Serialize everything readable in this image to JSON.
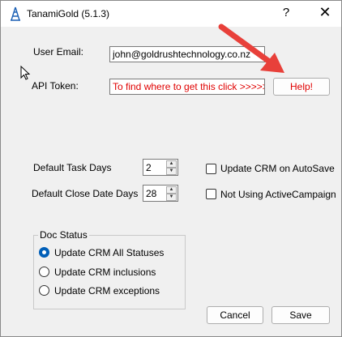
{
  "window": {
    "title": "TanamiGold (5.1.3)",
    "help_glyph": "?",
    "close_glyph": "✕"
  },
  "form": {
    "email_label": "User Email:",
    "email_value": "john@goldrushtechnology.co.nz",
    "api_label": "API Token:",
    "api_hint": "To find where to get this click >>>>>",
    "help_button": "Help!",
    "task_days_label": "Default Task Days",
    "task_days_value": "2",
    "close_days_label": "Default Close Date Days",
    "close_days_value": "28",
    "crm_autosave_label": "Update CRM on AutoSave",
    "crm_autosave_checked": false,
    "not_activecampaign_label": "Not Using ActiveCampaign",
    "not_activecampaign_checked": false
  },
  "doc_status": {
    "title": "Doc Status",
    "options": [
      {
        "label": "Update CRM All Statuses",
        "selected": true
      },
      {
        "label": "Update CRM inclusions",
        "selected": false
      },
      {
        "label": "Update CRM exceptions",
        "selected": false
      }
    ]
  },
  "buttons": {
    "cancel": "Cancel",
    "save": "Save"
  },
  "colors": {
    "hint_text": "#e00000",
    "help_text": "#e00000",
    "arrow": "#e8403a",
    "radio_selected": "#005fb8"
  }
}
